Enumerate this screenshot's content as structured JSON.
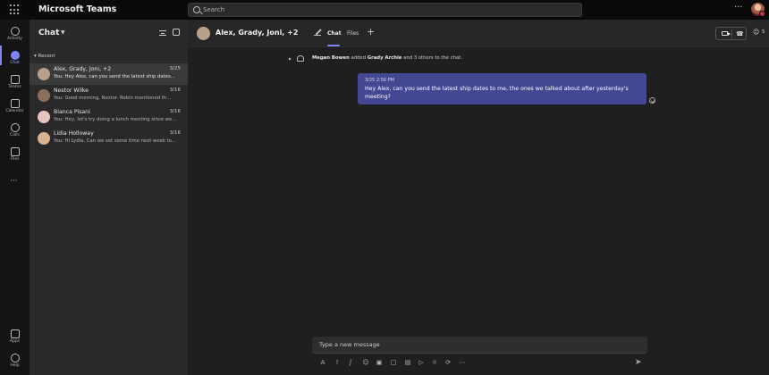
{
  "app": {
    "title": "Microsoft Teams"
  },
  "search": {
    "placeholder": "Search"
  },
  "topbar": {
    "more_label": "···"
  },
  "rail": {
    "items": [
      {
        "label": "Activity",
        "icon": "bell-icon"
      },
      {
        "label": "Chat",
        "icon": "chat-icon",
        "active": true
      },
      {
        "label": "Teams",
        "icon": "teams-icon"
      },
      {
        "label": "Calendar",
        "icon": "calendar-icon"
      },
      {
        "label": "Calls",
        "icon": "phone-icon"
      },
      {
        "label": "Files",
        "icon": "file-icon"
      }
    ],
    "more": "···",
    "bottom": [
      {
        "label": "Apps",
        "icon": "apps-icon"
      },
      {
        "label": "Help",
        "icon": "help-icon"
      }
    ]
  },
  "chatlist": {
    "title": "Chat",
    "section": "Recent",
    "items": [
      {
        "name": "Alex, Grady, Joni, +2",
        "date": "3/25",
        "preview": "You: Hey Alex, can you send the latest ship dates...",
        "selected": true,
        "avatar_color": "#b9a08a"
      },
      {
        "name": "Nestor Wilke",
        "date": "3/16",
        "preview": "You: Good morning, Nestor. Robin mentioned th...",
        "avatar_color": "#8b6f5c"
      },
      {
        "name": "Bianca Pisani",
        "date": "3/16",
        "preview": "You: Hey, let's try doing a lunch meeting since we...",
        "avatar_color": "#e8c4c0"
      },
      {
        "name": "Lidia Holloway",
        "date": "3/16",
        "preview": "You: Hi Lydia, Can we set some time next week to...",
        "avatar_color": "#d9b28f"
      }
    ]
  },
  "conversation": {
    "title": "Alex, Grady, Joni, +2",
    "tabs": [
      {
        "label": "Chat",
        "active": true
      },
      {
        "label": "Files"
      }
    ],
    "add_tab": "+",
    "people_count": "5",
    "system_message": {
      "actor": "Megan Bowen",
      "verb": " added ",
      "target": "Grady Archie",
      "rest": " and 3 others to the chat."
    },
    "message": {
      "meta": "3/25 2:56 PM",
      "text": "Hey Alex, can you send the latest ship dates to me, the ones we talked about after yesterday's meeting?"
    }
  },
  "compose": {
    "placeholder": "Type a new message"
  }
}
